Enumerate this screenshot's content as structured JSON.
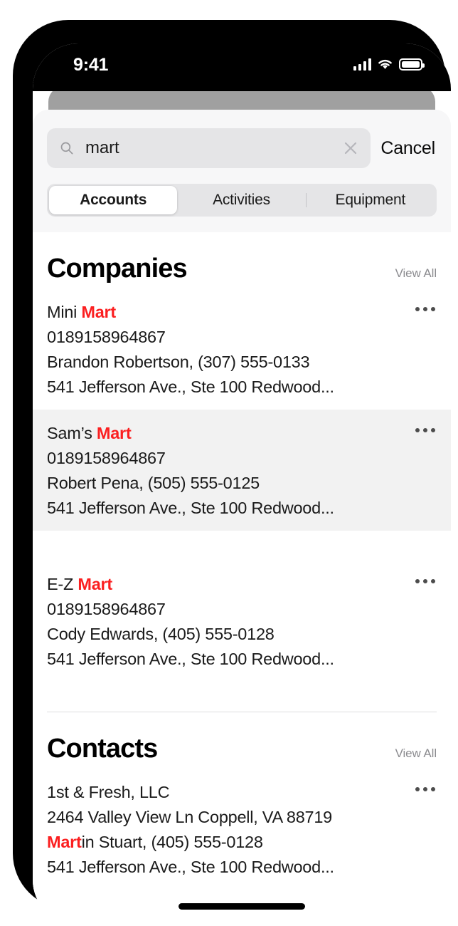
{
  "status_bar": {
    "time": "9:41",
    "signal_icon": "cellular-signal-icon",
    "wifi_icon": "wifi-icon",
    "battery_icon": "battery-icon"
  },
  "search": {
    "value": "mart",
    "placeholder": "Search",
    "search_icon": "search-icon",
    "clear_icon": "clear-icon",
    "cancel_label": "Cancel"
  },
  "segmented_control": {
    "selected": "Accounts",
    "tabs": [
      {
        "label": "Accounts",
        "active": true
      },
      {
        "label": "Activities",
        "active": false
      },
      {
        "label": "Equipment",
        "active": false
      }
    ]
  },
  "sections": [
    {
      "title": "Companies",
      "view_all_label": "View All",
      "items": [
        {
          "name_prefix": "Mini ",
          "name_highlight": "Mart",
          "name_suffix": "",
          "account_number": "0189158964867",
          "contact_line": "Brandon Robertson, (307) 555-0133",
          "address": "541 Jefferson Ave., Ste 100 Redwood...",
          "highlighted": false,
          "more_icon": "more-options-icon"
        },
        {
          "name_prefix": "Sam’s ",
          "name_highlight": "Mart",
          "name_suffix": "",
          "account_number": "0189158964867",
          "contact_line": "Robert Pena, (505) 555-0125",
          "address": "541 Jefferson Ave., Ste 100 Redwood...",
          "highlighted": true,
          "more_icon": "more-options-icon"
        },
        {
          "name_prefix": "E-Z ",
          "name_highlight": "Mart",
          "name_suffix": "",
          "account_number": "0189158964867",
          "contact_line": "Cody Edwards, (405) 555-0128",
          "address": "541 Jefferson Ave., Ste 100 Redwood...",
          "highlighted": false,
          "more_icon": "more-options-icon"
        }
      ]
    },
    {
      "title": "Contacts",
      "view_all_label": "View All",
      "items": [
        {
          "company": "1st & Fresh, LLC",
          "street": "2464 Valley View Ln  Coppell, VA 88719",
          "person_highlight": "Mart",
          "person_rest": "in Stuart, (405) 555-0128",
          "address": "541 Jefferson Ave., Ste 100 Redwood...",
          "highlighted": false,
          "more_icon": "more-options-icon"
        }
      ]
    }
  ],
  "colors": {
    "highlight_red": "#fb1f20",
    "row_highlight_bg": "#f2f2f2",
    "header_bg": "#f7f7f8",
    "search_field_bg": "#e5e5e7"
  }
}
